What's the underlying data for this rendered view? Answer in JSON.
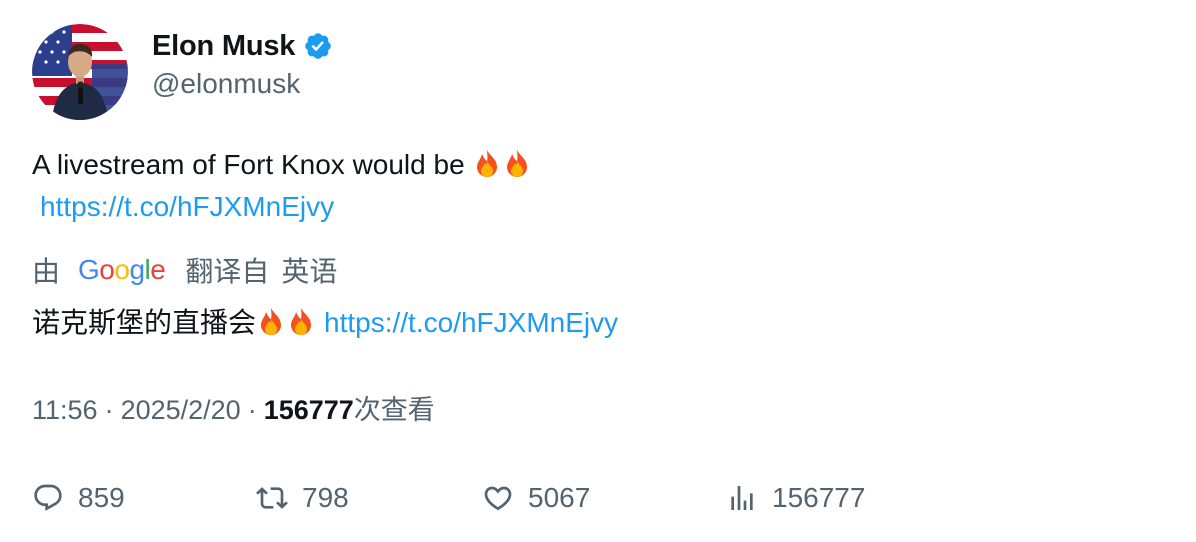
{
  "author": {
    "display_name": "Elon Musk",
    "handle": "@elonmusk",
    "verified": true
  },
  "tweet": {
    "text": "A livestream of Fort Knox would be",
    "emoji": "🔥🔥",
    "link": "https://t.co/hFJXMnEjvy"
  },
  "translation": {
    "by": "由",
    "provider": "Google",
    "translated_from": "翻译自",
    "language": "英语",
    "text": "诺克斯堡的直播会",
    "emoji": "🔥🔥",
    "link": "https://t.co/hFJXMnEjvy"
  },
  "meta": {
    "time": "11:56",
    "separator": "·",
    "date": "2025/2/20",
    "views_count": "156777",
    "views_label": "次查看"
  },
  "actions": {
    "replies": "859",
    "retweets": "798",
    "likes": "5067",
    "views": "156777"
  },
  "colors": {
    "link": "#1d9bf0",
    "secondary_text": "#536471",
    "primary_text": "#0f1419",
    "verified_badge": "#1d9bf0"
  },
  "icons": [
    "verified-badge-icon",
    "reply-icon",
    "retweet-icon",
    "like-icon",
    "views-icon",
    "fire-emoji"
  ]
}
